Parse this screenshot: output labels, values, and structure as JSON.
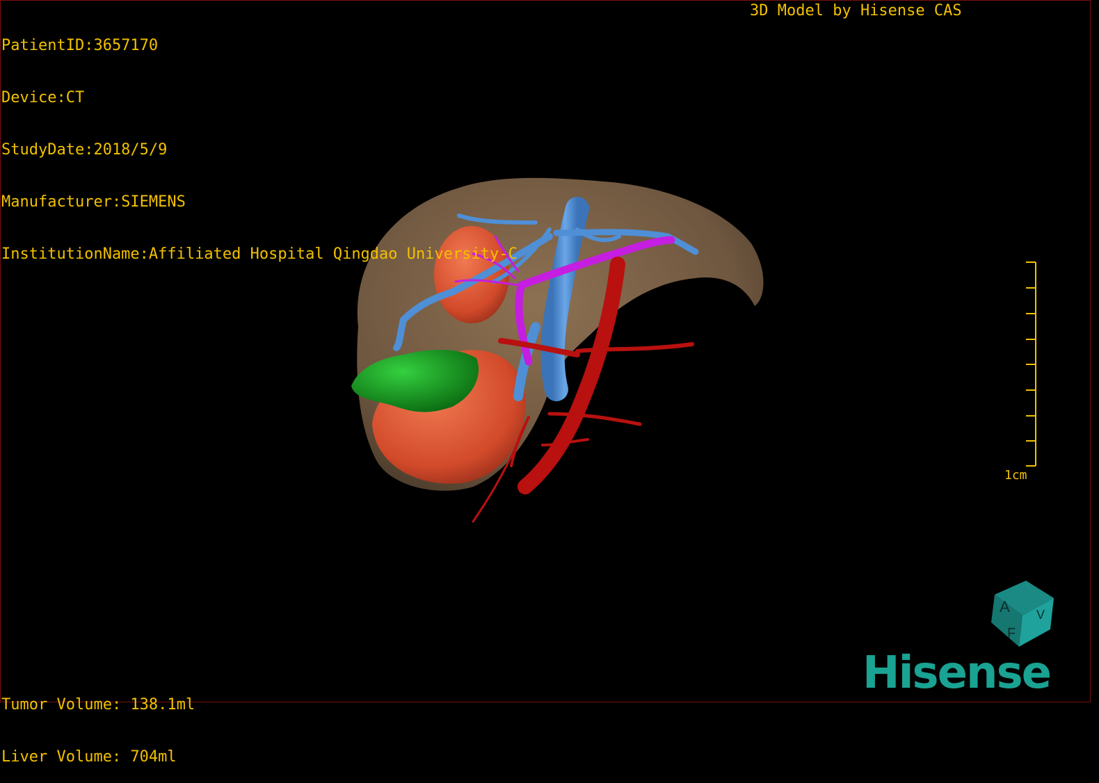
{
  "meta": {
    "patient_id": "PatientID:3657170",
    "device": "Device:CT",
    "study_date": "StudyDate:2018/5/9",
    "manufacturer": "Manufacturer:SIEMENS",
    "institution": "InstitutionName:Affiliated Hospital Qingdao University-C"
  },
  "header_right": "3D Model by Hisense CAS",
  "volumes": {
    "tumor": "Tumor Volume: 138.1ml",
    "liver": "Liver Volume: 704ml"
  },
  "scale_bar": {
    "label": "1cm"
  },
  "orientation_cube": {
    "faces": [
      "A",
      "F",
      "V"
    ]
  },
  "logo": "Hisense",
  "colors": {
    "overlay_text": "#f2c100",
    "liver": "#7a6148",
    "tumor": "#e05a38",
    "lesion_green": "#16a81e",
    "portal_vein_blue": "#4f8fd6",
    "bile_duct_magenta": "#c51ee0",
    "artery_red": "#b8110f",
    "brand_teal": "#1aa292"
  }
}
